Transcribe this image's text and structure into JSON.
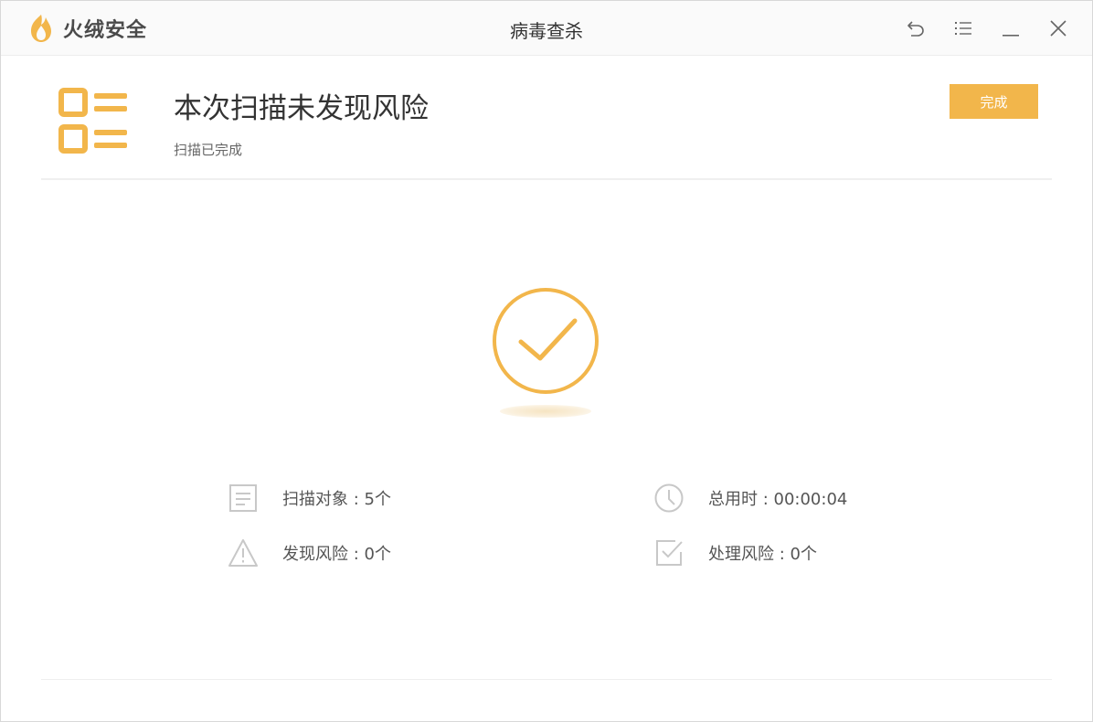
{
  "app": {
    "brand_name": "火绒安全",
    "window_title": "病毒查杀",
    "accent_color": "#f2b64b"
  },
  "controls": {
    "icons": [
      "back-icon",
      "menu-icon",
      "minimize-icon",
      "close-icon"
    ]
  },
  "header": {
    "title": "本次扫描未发现风险",
    "subtitle": "扫描已完成",
    "done_label": "完成"
  },
  "result": {
    "icon": "check-circle-icon"
  },
  "stats": {
    "scan_objects": "扫描对象 : 5个",
    "total_time": "总用时 : 00:00:04",
    "risks_found": "发现风险 : 0个",
    "risks_handled": "处理风险 : 0个"
  }
}
